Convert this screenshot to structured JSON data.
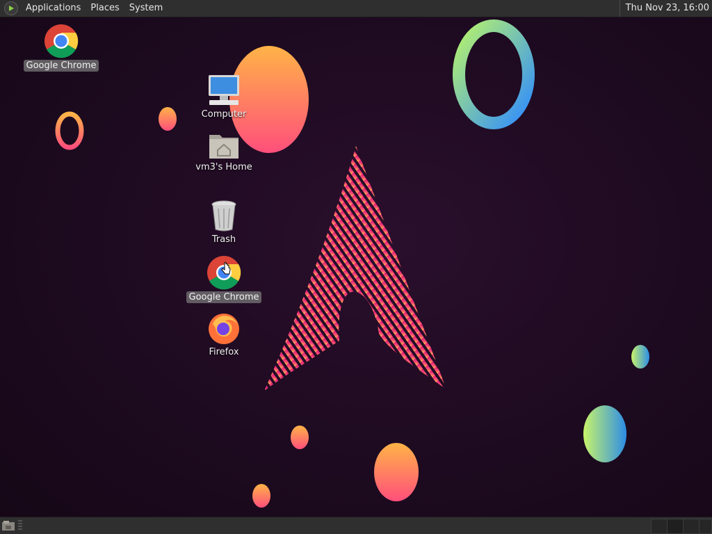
{
  "top_panel": {
    "menus": [
      "Applications",
      "Places",
      "System"
    ],
    "clock": "Thu Nov 23, 16:00"
  },
  "desktop_icons": {
    "chrome_topleft": "Google Chrome",
    "computer": "Computer",
    "home": "vm3's Home",
    "trash": "Trash",
    "chrome": "Google Chrome",
    "firefox": "Firefox"
  },
  "colors": {
    "panel": "#2f2f2f",
    "wallpaper": "#1c0b1f",
    "accent": "#e0246e"
  }
}
